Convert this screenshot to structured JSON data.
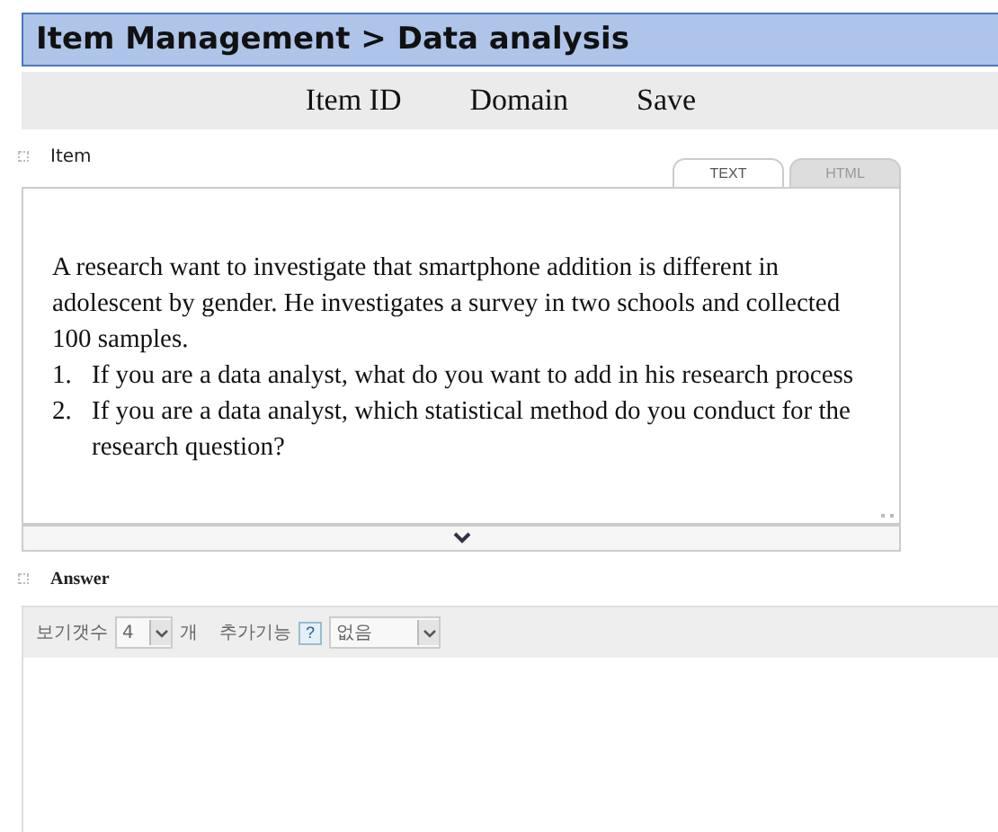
{
  "title": "Item Management > Data analysis",
  "nav": [
    "Item ID",
    "Domain",
    "Save"
  ],
  "item": {
    "label": "Item",
    "tabs": [
      {
        "label": "TEXT",
        "selected": true
      },
      {
        "label": "HTML",
        "selected": false
      }
    ],
    "paragraph": "A research want to investigate that smartphone addition is different in adolescent by gender. He investigates a survey in two schools and collected 100 samples.",
    "list": [
      {
        "number": "1.",
        "text": "If you are a data analyst, what do you want to add in his research process"
      },
      {
        "number": "2.",
        "text": "If you are a data analyst, which statistical method do you conduct for the research question?"
      }
    ]
  },
  "answer": {
    "label": "Answer",
    "count_label": "보기갯수",
    "count_value": "4",
    "count_unit": "개",
    "extra_label": "추가기능",
    "help": "?",
    "extra_value": "없음"
  }
}
